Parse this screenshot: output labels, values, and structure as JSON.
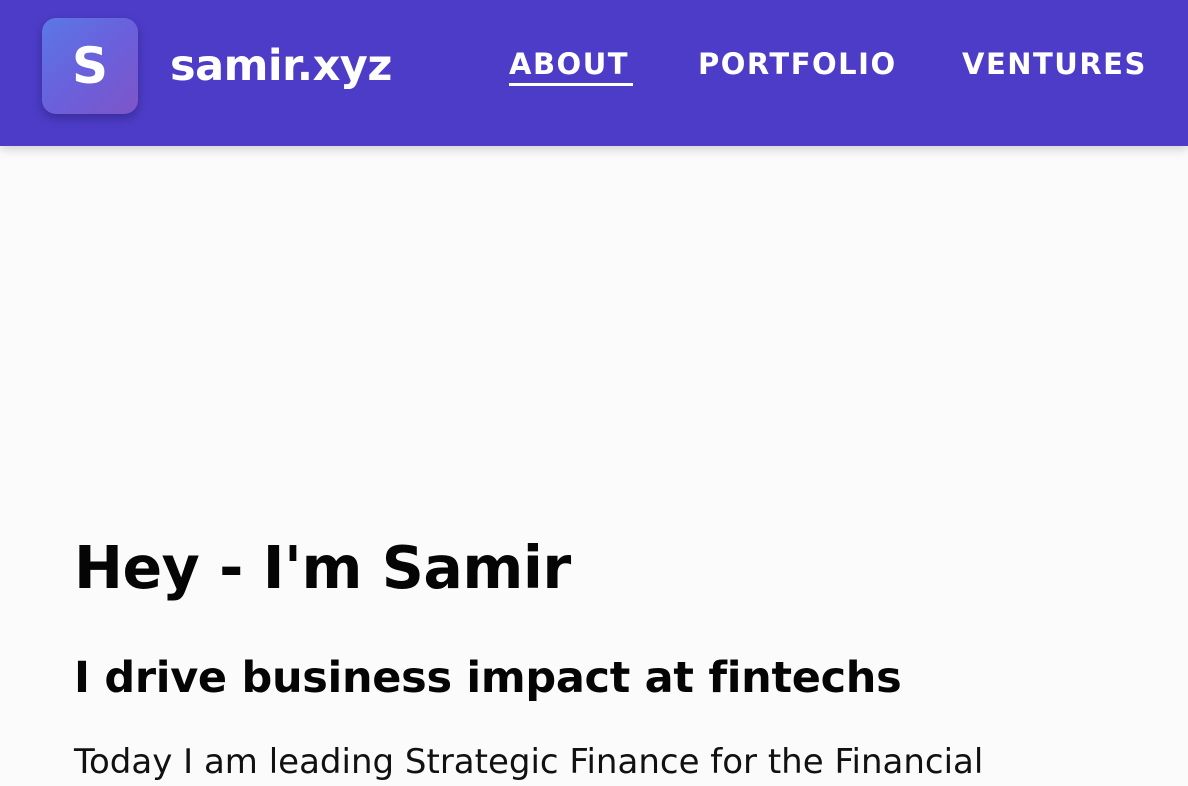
{
  "header": {
    "logo_letter": "S",
    "site_name": "samir.xyz",
    "nav": [
      {
        "label": "ABOUT",
        "active": true
      },
      {
        "label": "PORTFOLIO",
        "active": false
      },
      {
        "label": "VENTURES",
        "active": false
      }
    ]
  },
  "main": {
    "greeting": "Hey - I'm Samir",
    "tagline": "I drive business impact at fintechs",
    "intro_partial": "Today I am leading Strategic Finance for the Financial"
  },
  "colors": {
    "nav_background": "#4d3cc8",
    "logo_gradient_start": "#5b78e6",
    "logo_gradient_end": "#7e55c8",
    "page_background": "#fbfbfb",
    "text": "#050505"
  }
}
